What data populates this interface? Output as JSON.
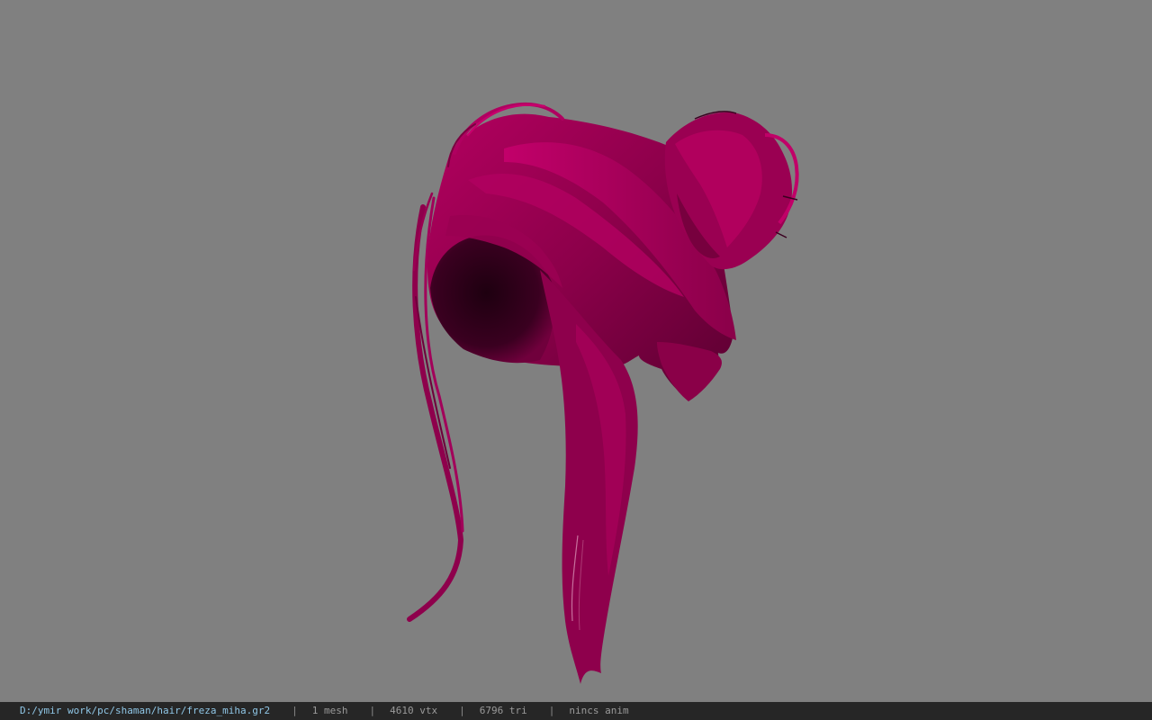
{
  "viewport": {
    "background_color": "#808080",
    "model": {
      "name": "hair mesh",
      "color": "#a0005a"
    }
  },
  "statusbar": {
    "path": "D:/ymir work/pc/shaman/hair/freza_miha.gr2",
    "separator": "|",
    "mesh_count": "1 mesh",
    "vertex_count": "4610 vtx",
    "triangle_count": "6796 tri",
    "anim_status": "nincs anim"
  }
}
